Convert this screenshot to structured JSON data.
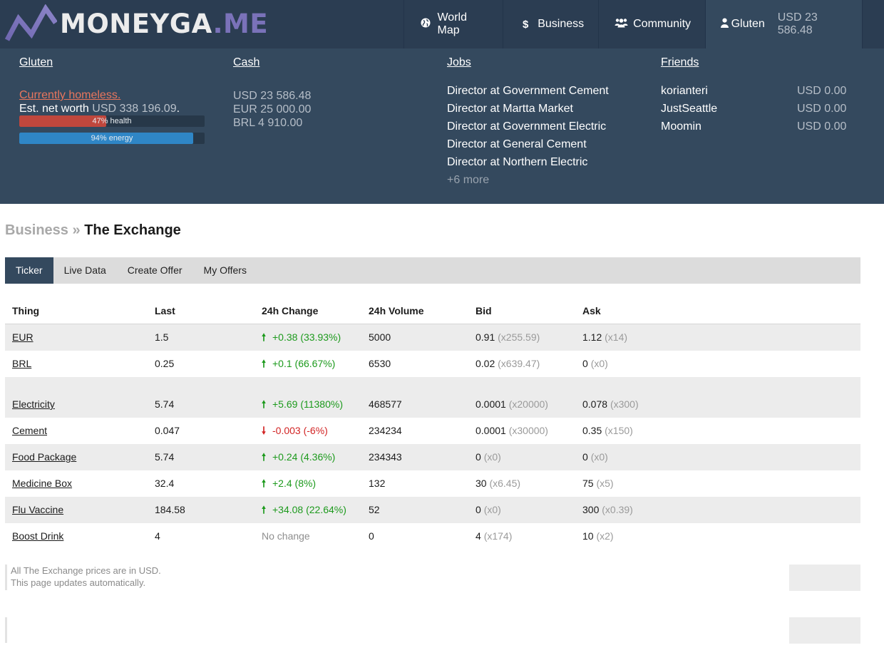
{
  "brand": {
    "logo_primary": "MONEYGA",
    "logo_secondary": ".ME",
    "accent_color": "#7a72b9"
  },
  "nav": {
    "items": [
      {
        "label": "World Map",
        "icon": "globe-icon"
      },
      {
        "label": "Business",
        "icon": "dollar-icon"
      },
      {
        "label": "Community",
        "icon": "users-icon"
      }
    ],
    "user": {
      "name": "Gluten",
      "icon": "user-icon",
      "balance": "USD 23 586.48"
    }
  },
  "profile": {
    "title": "Gluten",
    "status": "Currently homeless.",
    "networth_label": "Est. net worth",
    "networth_value": "USD 338 196.09",
    "networth_suffix": ".",
    "health": {
      "value": 47,
      "label": "47% health",
      "color": "#c0473d"
    },
    "energy": {
      "value": 94,
      "label": "94% energy",
      "color": "#2f86c6"
    }
  },
  "cash": {
    "title": "Cash",
    "lines": [
      "USD 23 586.48",
      "EUR 25 000.00",
      "BRL 4 910.00"
    ]
  },
  "jobs": {
    "title": "Jobs",
    "items": [
      "Director at Government Cement",
      "Director at Martta Market",
      "Director at Government Electric",
      "Director at General Cement",
      "Director at Northern Electric"
    ],
    "more": "+6 more"
  },
  "friends": {
    "title": "Friends",
    "items": [
      {
        "name": "korianteri",
        "balance": "USD 0.00"
      },
      {
        "name": "JustSeattle",
        "balance": "USD 0.00"
      },
      {
        "name": "Moomin",
        "balance": "USD 0.00"
      }
    ]
  },
  "breadcrumb": {
    "parent": "Business",
    "separator": "»",
    "current": "The Exchange"
  },
  "tabs": [
    {
      "label": "Ticker",
      "active": true
    },
    {
      "label": "Live Data",
      "active": false
    },
    {
      "label": "Create Offer",
      "active": false
    },
    {
      "label": "My Offers",
      "active": false
    }
  ],
  "table": {
    "headers": {
      "thing": "Thing",
      "last": "Last",
      "change": "24h Change",
      "volume": "24h Volume",
      "bid": "Bid",
      "ask": "Ask"
    },
    "currency_rows": [
      {
        "thing": "EUR",
        "last": "1.5",
        "dir": "up",
        "change": "+0.38 (33.93%)",
        "volume": "5000",
        "bid": "0.91",
        "bid_qty": "(x255.59)",
        "ask": "1.12",
        "ask_qty": "(x14)"
      },
      {
        "thing": "BRL",
        "last": "0.25",
        "dir": "up",
        "change": "+0.1 (66.67%)",
        "volume": "6530",
        "bid": "0.02",
        "bid_qty": "(x639.47)",
        "ask": "0",
        "ask_qty": "(x0)"
      }
    ],
    "item_rows": [
      {
        "thing": "Electricity",
        "last": "5.74",
        "dir": "up",
        "change": "+5.69 (11380%)",
        "volume": "468577",
        "bid": "0.0001",
        "bid_qty": "(x20000)",
        "ask": "0.078",
        "ask_qty": "(x300)"
      },
      {
        "thing": "Cement",
        "last": "0.047",
        "dir": "down",
        "change": "-0.003 (-6%)",
        "volume": "234234",
        "bid": "0.0001",
        "bid_qty": "(x30000)",
        "ask": "0.35",
        "ask_qty": "(x150)"
      },
      {
        "thing": "Food Package",
        "last": "5.74",
        "dir": "up",
        "change": "+0.24 (4.36%)",
        "volume": "234343",
        "bid": "0",
        "bid_qty": "(x0)",
        "ask": "0",
        "ask_qty": "(x0)"
      },
      {
        "thing": "Medicine Box",
        "last": "32.4",
        "dir": "up",
        "change": "+2.4 (8%)",
        "volume": "132",
        "bid": "30",
        "bid_qty": "(x6.45)",
        "ask": "75",
        "ask_qty": "(x5)"
      },
      {
        "thing": "Flu Vaccine",
        "last": "184.58",
        "dir": "up",
        "change": "+34.08 (22.64%)",
        "volume": "52",
        "bid": "0",
        "bid_qty": "(x0)",
        "ask": "300",
        "ask_qty": "(x0.39)"
      },
      {
        "thing": "Boost Drink",
        "last": "4",
        "dir": "none",
        "change": "No change",
        "volume": "0",
        "bid": "4",
        "bid_qty": "(x174)",
        "ask": "10",
        "ask_qty": "(x2)"
      }
    ]
  },
  "footer": {
    "note_line1": "All The Exchange prices are in USD.",
    "note_line2": "This page updates automatically."
  }
}
